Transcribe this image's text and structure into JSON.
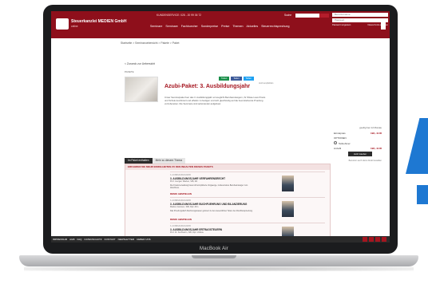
{
  "laptop": {
    "brand": "MacBook Air"
  },
  "header": {
    "logo_name": "Steuerkanzlei MEDIEN GmbH",
    "logo_sub": "online",
    "hotline": "KUNDENSERVICE: 028 - 20 99 36 72",
    "nav": [
      "Seminare",
      "Seminare",
      "Fachbuecher",
      "Sonderpreise",
      "Preise",
      "Themen",
      "Aktuelles",
      "Steuerrechtsprechung"
    ],
    "search_label": "Suche",
    "login_user": "Benutzername",
    "login_pass": "Passwort",
    "login_links": [
      "Passwort vergessen",
      "Neues Konto erstellen"
    ]
  },
  "breadcrumb": "Startseite > Seminaruebersicht > Pakete > Paket",
  "content": {
    "back_link": "< Zurueck zur Uebersicht",
    "small_title": "PAKETE",
    "share": [
      "Teilen",
      "Teilen",
      "Teilen"
    ],
    "share_note": "Jetzt empfehlen",
    "product_title": "Azubi-Paket: 3. Ausbildungsjahr",
    "description": "Unser Seminarpaket fuer das 3. Ausbildungsjahr ermoeglicht Berufseinsteigern, ihr Wissen aus Praxis und Schule kombiniert und effektiv zu festigen und sich gleichzeitig auf die bevorstehende Pruefung vorzubereiten. Die Seminare sind aufeinander aufgebaut.",
    "side": {
      "valid": "gueltig fuer 12 Monate",
      "price_label": "Einzelpreis",
      "price_value": "198,- EUR",
      "options_label": "OPTIONEN",
      "option_1": "Teilnehmer",
      "qty_label": "Anzahl",
      "total": "198,- EUR",
      "cart_button": "Jetzt kaufen",
      "notice": "Benutzer auch dann direkt bestellen"
    },
    "tabs": [
      "Im Paket enthalten",
      "Mehr zu diesem Thema"
    ],
    "panel_title": "ERFAHREN SIE MEHR EINZELHEITEN ZU DEN INHALTEN DIESES PAKETS",
    "modules": [
      {
        "category": "3. AUSBILDUNGSJAHR",
        "title": "3. AUSBILDUNGSJAHR VERFAHRENSRECHT",
        "author": "Prof. Juergen Wacker, StB, RA",
        "text": "Die Finanzverwaltung bietet oft komplizierte Vorgaenge, insbesondere Berufseinsteiger zum Abschluss.",
        "demo": "DEMO ABSPIELEN"
      },
      {
        "category": "3. AUSBILDUNGSJAHR",
        "title": "3. AUSBILDUNGSJAHR BUCHFUEHRUNG UND BILANZIERUNG",
        "author": "Markus Janssen, StB, Dipl.-Kfm.",
        "text": "Das Pruefungsfach Rechnungswesen gehoert zu den wesentlichen Teilen der Abschlusspruefung.",
        "demo": "DEMO ABSPIELEN"
      },
      {
        "category": "3. AUSBILDUNGSJAHR",
        "title": "3. AUSBILDUNGSJAHR ERTRAGSTEUERN",
        "author": "Prof. Dr. Kai Buehn, StB, Dipl. Volksw.",
        "text": "",
        "demo": ""
      }
    ]
  },
  "footer": {
    "links": [
      "IMPRESSUM",
      "AGB",
      "FAQ",
      "DATENSCHUTZ",
      "KONTAKT",
      "NEWSLETTER",
      "UEBER UNS"
    ],
    "social": [
      "youtube-icon",
      "facebook-icon",
      "xing-icon",
      "rss-icon"
    ]
  },
  "colors": {
    "brand": "#8e0f1b",
    "accent": "#a5151f",
    "deco": "#1e78d2"
  }
}
